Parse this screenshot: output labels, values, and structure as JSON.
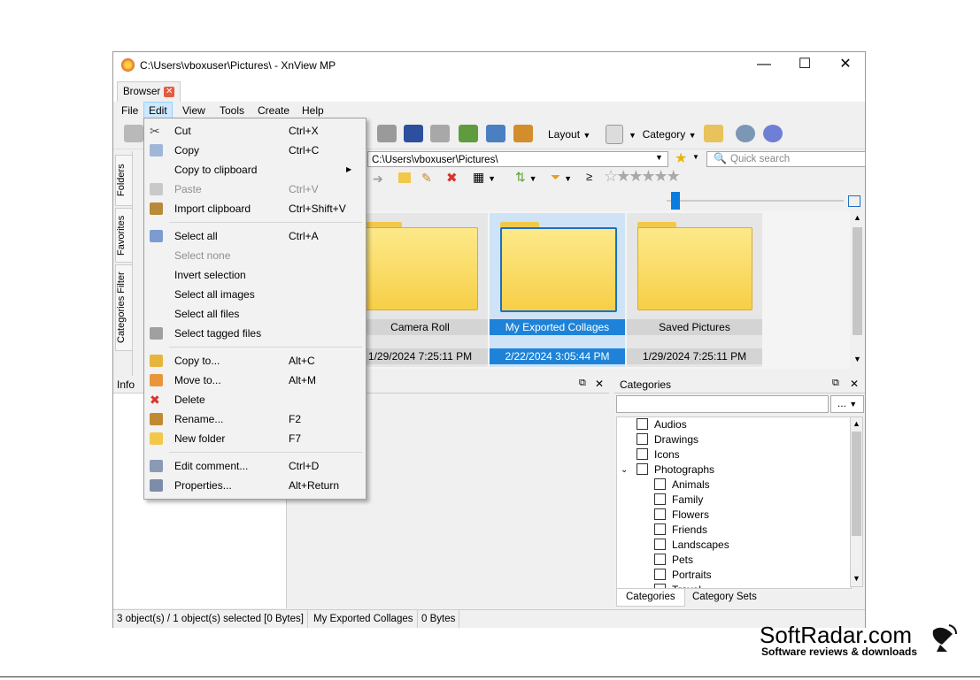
{
  "window": {
    "title": "C:\\Users\\vboxuser\\Pictures\\ - XnView MP",
    "minimize": "—",
    "maximize": "☐",
    "close": "✕"
  },
  "tabs": {
    "browser": "Browser",
    "close": "✕"
  },
  "menubar": [
    "File",
    "Edit",
    "View",
    "Tools",
    "Create",
    "Help"
  ],
  "toolbar": {
    "layout": "Layout",
    "category": "Category"
  },
  "side_tabs": [
    "Folders",
    "Favorites",
    "Categories Filter"
  ],
  "address": {
    "path": "C:\\Users\\vboxuser\\Pictures\\",
    "search_placeholder": "Quick search"
  },
  "filter": {
    "ge": "≥"
  },
  "thumbnails": [
    {
      "name": "Camera Roll",
      "date": "1/29/2024 7:25:11 PM",
      "selected": false
    },
    {
      "name": "My Exported Collages",
      "date": "2/22/2024 3:05:44 PM",
      "selected": true
    },
    {
      "name": "Saved Pictures",
      "date": "1/29/2024 7:25:11 PM",
      "selected": false
    }
  ],
  "panels": {
    "info": "Info",
    "categories": "Categories",
    "dots": "...",
    "dock": "⧉",
    "close": "✕"
  },
  "categories": [
    {
      "label": "Audios",
      "level": 0
    },
    {
      "label": "Drawings",
      "level": 0
    },
    {
      "label": "Icons",
      "level": 0
    },
    {
      "label": "Photographs",
      "level": 0,
      "expanded": true
    },
    {
      "label": "Animals",
      "level": 1
    },
    {
      "label": "Family",
      "level": 1
    },
    {
      "label": "Flowers",
      "level": 1
    },
    {
      "label": "Friends",
      "level": 1
    },
    {
      "label": "Landscapes",
      "level": 1
    },
    {
      "label": "Pets",
      "level": 1
    },
    {
      "label": "Portraits",
      "level": 1
    },
    {
      "label": "Travel",
      "level": 1
    }
  ],
  "category_tabs": [
    "Categories",
    "Category Sets"
  ],
  "status": [
    "3 object(s) / 1 object(s) selected [0 Bytes]",
    "My Exported Collages",
    "0 Bytes"
  ],
  "edit_menu": {
    "items": [
      {
        "label": "Cut",
        "shortcut": "Ctrl+X",
        "icon": "scissors-icon"
      },
      {
        "label": "Copy",
        "shortcut": "Ctrl+C",
        "icon": "copy-icon"
      },
      {
        "label": "Copy to clipboard",
        "shortcut": "",
        "submenu": true
      },
      {
        "label": "Paste",
        "shortcut": "Ctrl+V",
        "disabled": true,
        "icon": "paste-icon"
      },
      {
        "label": "Import clipboard",
        "shortcut": "Ctrl+Shift+V",
        "icon": "clipboard-icon"
      },
      {
        "label": "Select all",
        "shortcut": "Ctrl+A",
        "icon": "select-all-icon"
      },
      {
        "label": "Select none",
        "shortcut": "",
        "disabled": true
      },
      {
        "label": "Invert selection",
        "shortcut": ""
      },
      {
        "label": "Select all images",
        "shortcut": ""
      },
      {
        "label": "Select all files",
        "shortcut": ""
      },
      {
        "label": "Select tagged files",
        "shortcut": "",
        "icon": "tagged-icon"
      },
      {
        "label": "Copy to...",
        "shortcut": "Alt+C",
        "icon": "folder-copy-icon"
      },
      {
        "label": "Move to...",
        "shortcut": "Alt+M",
        "icon": "folder-move-icon"
      },
      {
        "label": "Delete",
        "shortcut": "",
        "icon": "delete-icon"
      },
      {
        "label": "Rename...",
        "shortcut": "F2",
        "icon": "rename-icon"
      },
      {
        "label": "New folder",
        "shortcut": "F7",
        "icon": "new-folder-icon"
      },
      {
        "label": "Edit comment...",
        "shortcut": "Ctrl+D",
        "icon": "comment-icon"
      },
      {
        "label": "Properties...",
        "shortcut": "Alt+Return",
        "icon": "properties-icon"
      }
    ]
  },
  "watermark": {
    "brand": "SoftRadar.com",
    "tagline": "Software reviews & downloads"
  },
  "colors": {
    "selection": "#1e83d8",
    "menu_active": "#cde8ff",
    "folder": "#f7cf47",
    "delete": "#d9342b"
  }
}
